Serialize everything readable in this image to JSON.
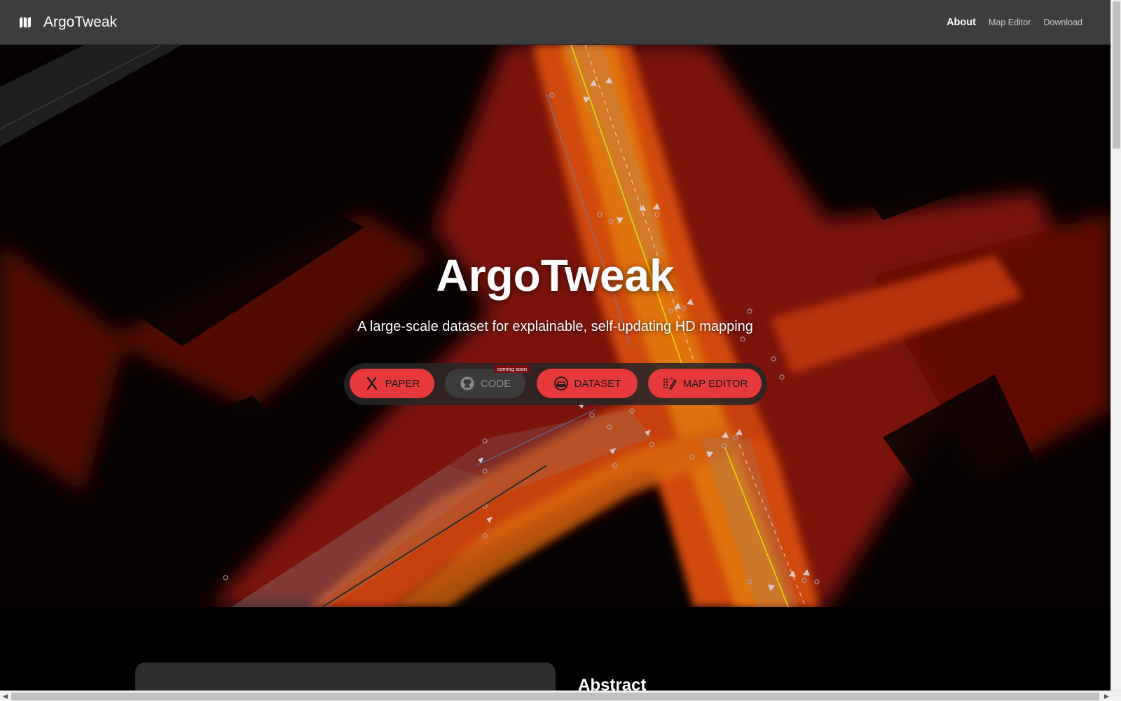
{
  "navbar": {
    "brand": "ArgoTweak",
    "brand_icon": "map-icon",
    "links": [
      {
        "label": "About",
        "active": true
      },
      {
        "label": "Map Editor",
        "active": false
      },
      {
        "label": "Download",
        "active": false
      }
    ]
  },
  "hero": {
    "title": "ArgoTweak",
    "subtitle": "A large-scale dataset for explainable, self-updating HD mapping",
    "buttons": {
      "paper": {
        "label": "PAPER",
        "icon": "arxiv-icon"
      },
      "code": {
        "label": "CODE",
        "icon": "github-icon",
        "badge": "coming soon",
        "disabled": true
      },
      "dataset": {
        "label": "DATASET",
        "icon": "car-icon"
      },
      "map_editor": {
        "label": "MAP EDITOR",
        "icon": "pen-tool-icon"
      }
    }
  },
  "abstract": {
    "title": "Abstract"
  },
  "colors": {
    "navbar_bg": "#3d3d3d",
    "accent_red": "#e8393a",
    "disabled_gray": "#3b3b3b",
    "badge_red": "#7a0c10"
  }
}
